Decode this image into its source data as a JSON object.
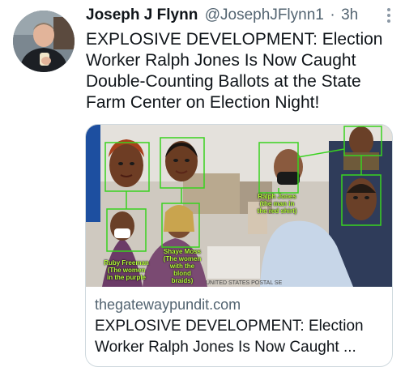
{
  "author": {
    "name": "Joseph J Flynn",
    "handle": "@JosephJFlynn1",
    "separator": "·",
    "time": "3h"
  },
  "tweet": {
    "text": "EXPLOSIVE DEVELOPMENT: Election Worker Ralph Jones Is Now Caught Double-Counting Ballots at the State Farm Center on Election Night!"
  },
  "card": {
    "domain": "thegatewaypundit.com",
    "title": "EXPLOSIVE DEVELOPMENT: Election Worker Ralph Jones Is Now Caught ...",
    "image_labels": {
      "ralph": "Ralph Jones\n(the man in\nthe red shirt)",
      "shaye": "Shaye Moss\n(The women\nwith the\nblond braids)",
      "ruby": "Ruby Freeman\n(The women\nin the purple",
      "box_text": "UNITED STATES POSTAL SE"
    }
  },
  "icons": {
    "more": "more-vertical-icon"
  }
}
